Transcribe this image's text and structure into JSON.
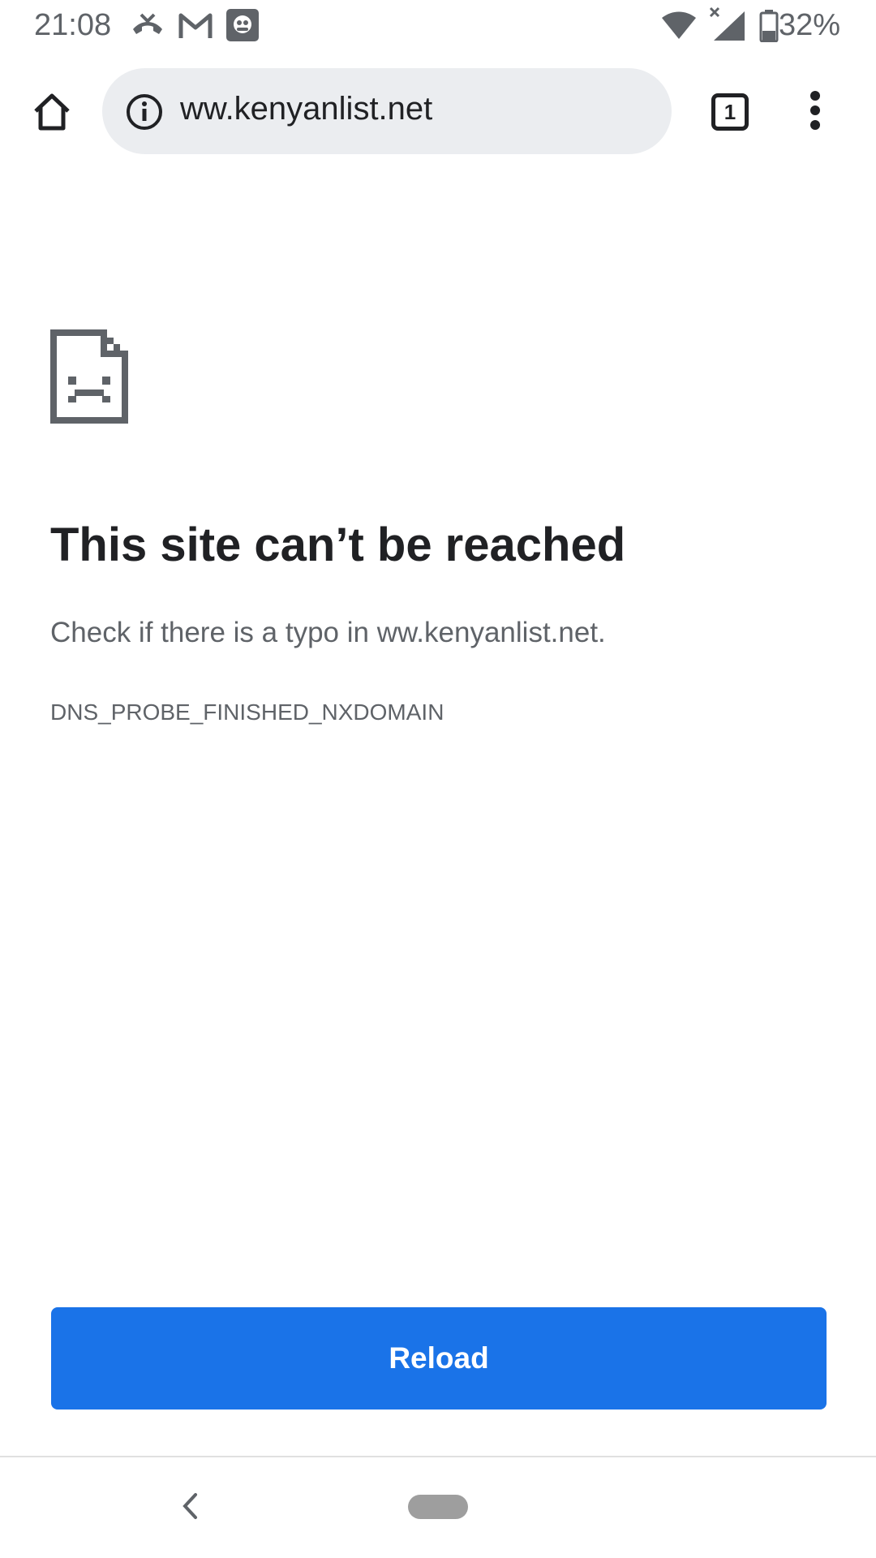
{
  "status_bar": {
    "time": "21:08",
    "battery": "32%",
    "icons_left": [
      "missed-call-icon",
      "gmail-icon",
      "app-notification-icon"
    ],
    "icons_right": [
      "wifi-icon",
      "no-signal-icon",
      "battery-icon"
    ]
  },
  "toolbar": {
    "url": "ww.kenyanlist.net",
    "tab_count": "1",
    "icons": [
      "home-icon",
      "info-icon",
      "tab-switcher-icon",
      "more-vert-icon"
    ]
  },
  "error_page": {
    "icon": "sad-document-icon",
    "heading": "This site can’t be reached",
    "description": "Check if there is a typo in ww.kenyanlist.net.",
    "error_code": "DNS_PROBE_FINISHED_NXDOMAIN",
    "reload_label": "Reload"
  },
  "nav_bar": {
    "icons": [
      "back-icon",
      "home-pill"
    ]
  },
  "colors": {
    "accent": "#1a73e8",
    "omnibox_bg": "#ebedf0",
    "text_primary": "#202124",
    "text_secondary": "#5f6368"
  }
}
